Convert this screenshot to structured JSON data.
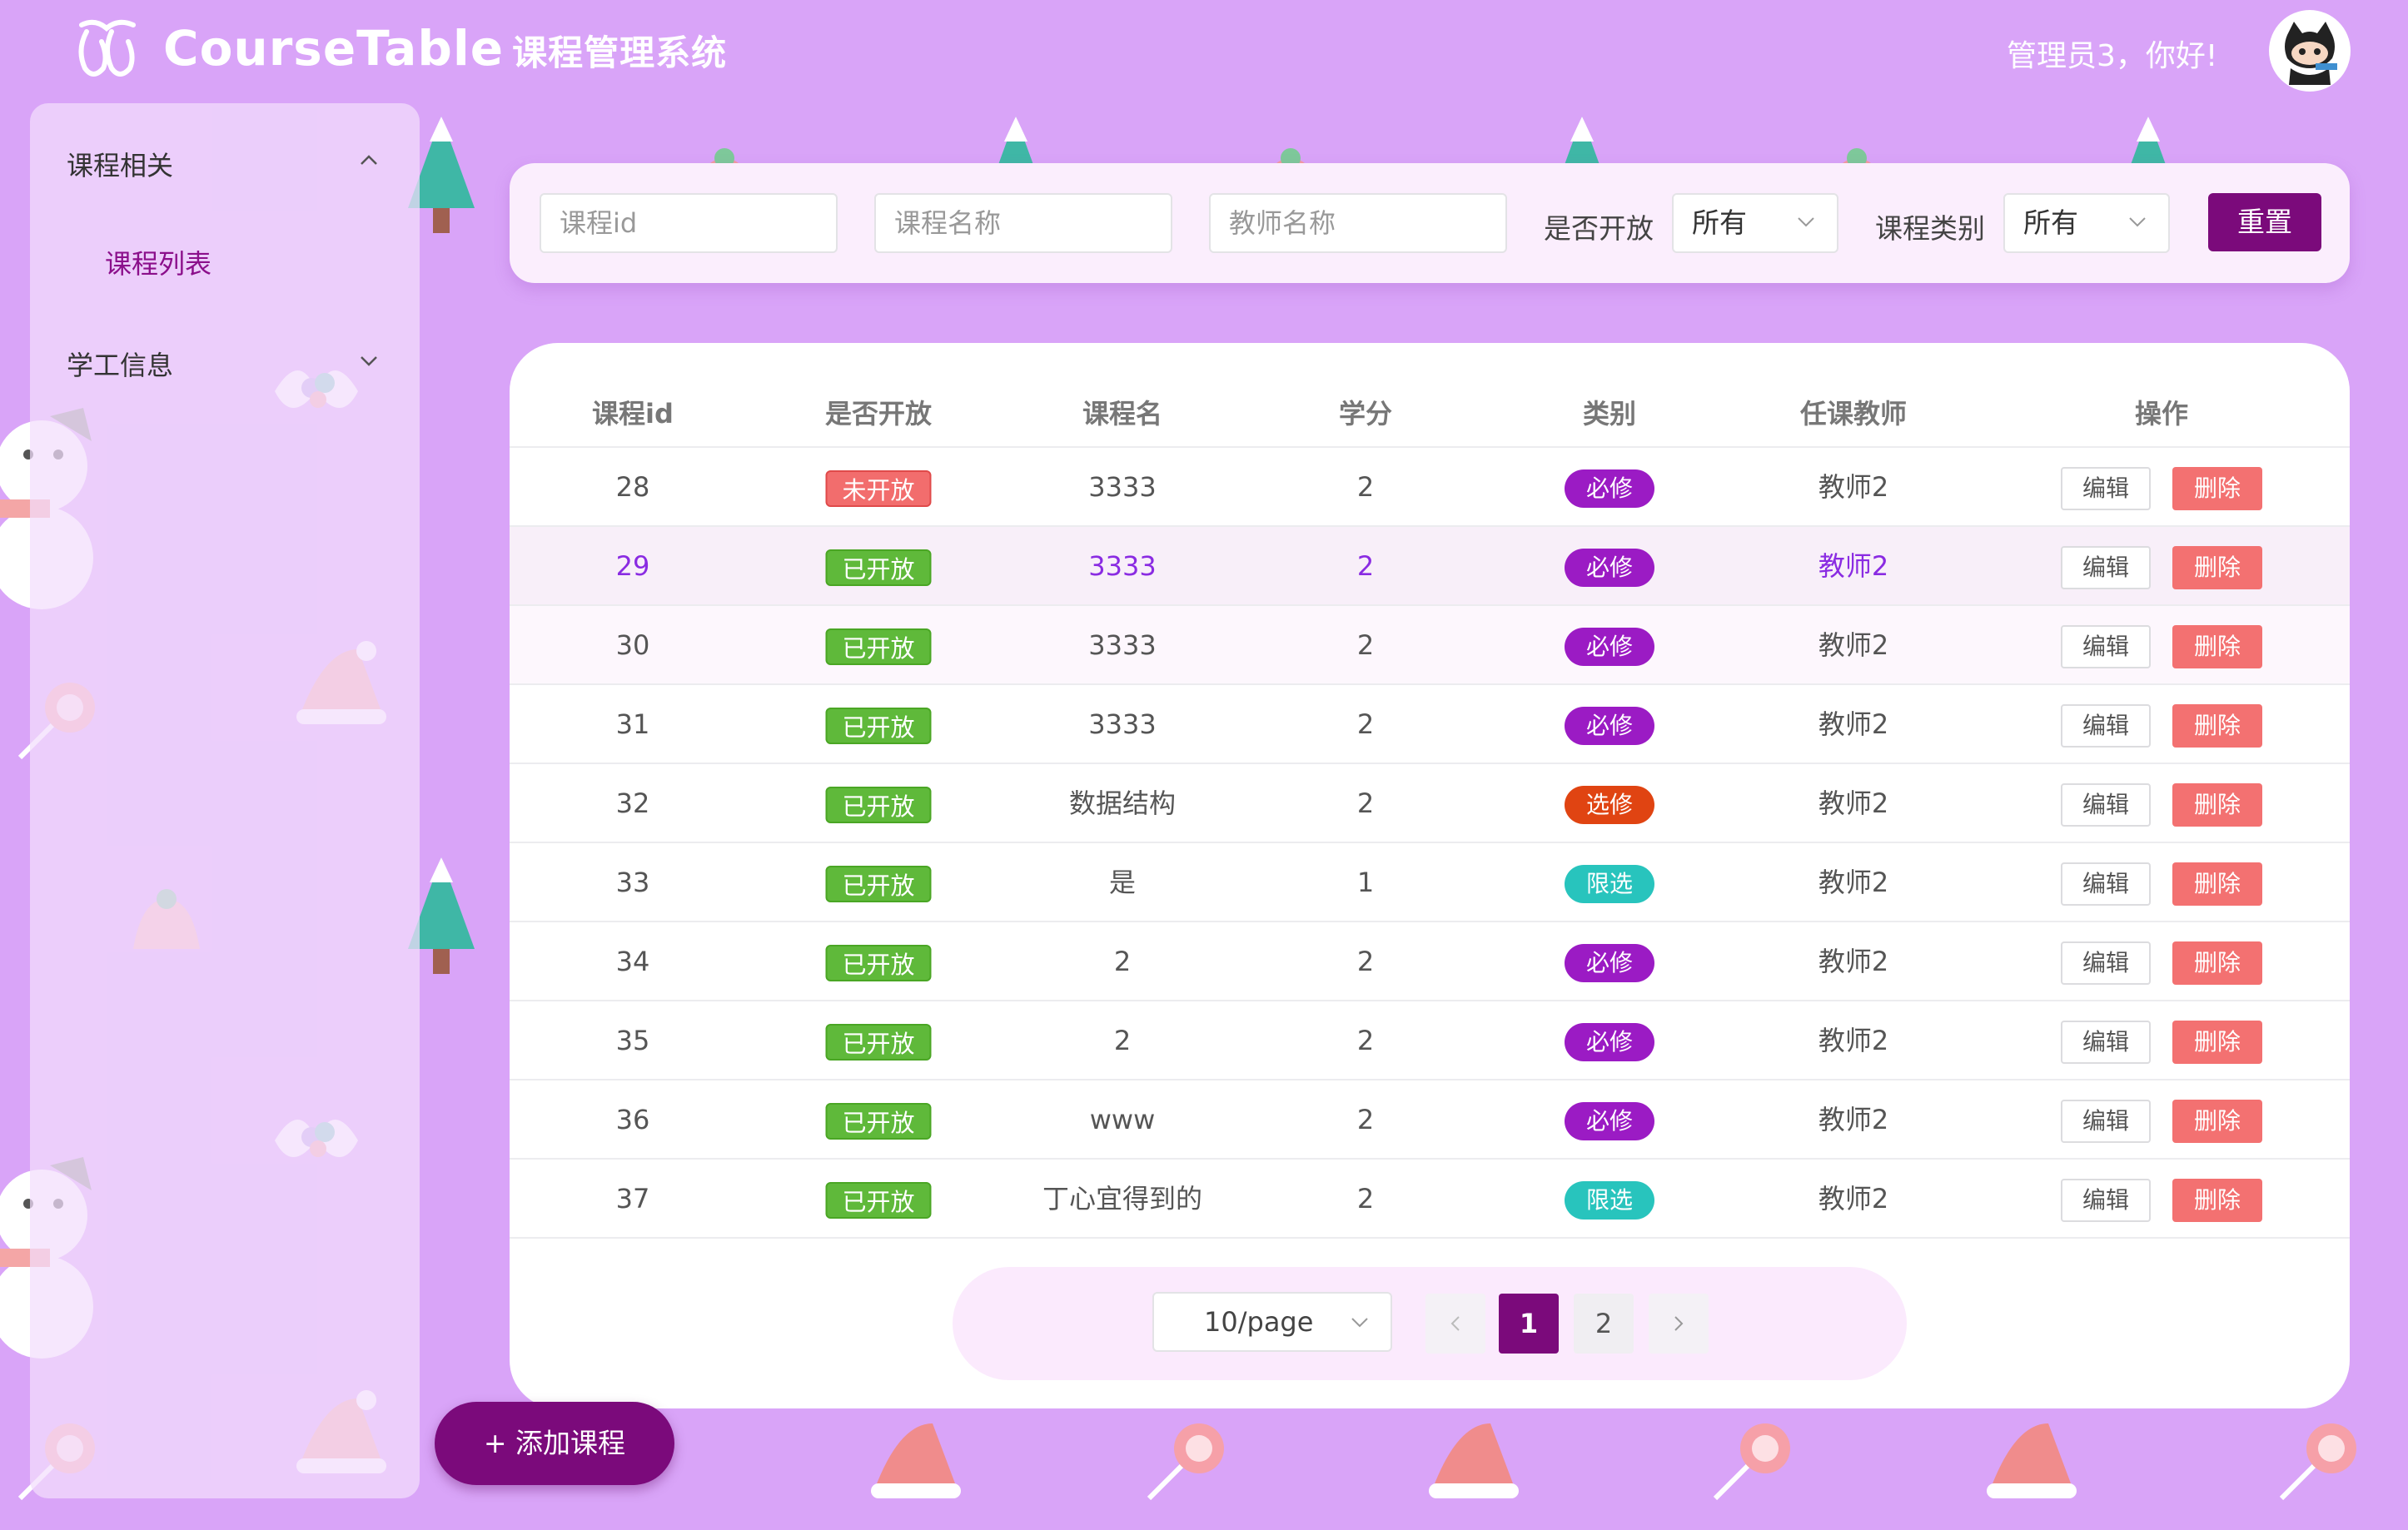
{
  "header": {
    "brand": "CourseTable",
    "brand_cn": "课程管理系统",
    "greeting": "管理员3，你好!",
    "avatar_icon": "octocat-avatar-icon"
  },
  "sidebar": {
    "groups": [
      {
        "label": "课程相关",
        "expanded": true,
        "items": [
          {
            "label": "课程列表",
            "active": true
          }
        ]
      },
      {
        "label": "学工信息",
        "expanded": false,
        "items": []
      }
    ]
  },
  "filters": {
    "course_id_placeholder": "课程id",
    "course_name_placeholder": "课程名称",
    "teacher_name_placeholder": "教师名称",
    "open_label": "是否开放",
    "open_value": "所有",
    "type_label": "课程类别",
    "type_value": "所有",
    "reset_label": "重置"
  },
  "table": {
    "columns": [
      "课程id",
      "是否开放",
      "课程名",
      "学分",
      "类别",
      "任课教师",
      "操作"
    ],
    "edit_label": "编辑",
    "delete_label": "删除",
    "rows": [
      {
        "id": "28",
        "status": "未开放",
        "name": "3333",
        "credit": "2",
        "type": "必修",
        "teacher": "教师2"
      },
      {
        "id": "29",
        "status": "已开放",
        "name": "3333",
        "credit": "2",
        "type": "必修",
        "teacher": "教师2"
      },
      {
        "id": "30",
        "status": "已开放",
        "name": "3333",
        "credit": "2",
        "type": "必修",
        "teacher": "教师2"
      },
      {
        "id": "31",
        "status": "已开放",
        "name": "3333",
        "credit": "2",
        "type": "必修",
        "teacher": "教师2"
      },
      {
        "id": "32",
        "status": "已开放",
        "name": "数据结构",
        "credit": "2",
        "type": "选修",
        "teacher": "教师2"
      },
      {
        "id": "33",
        "status": "已开放",
        "name": "是",
        "credit": "1",
        "type": "限选",
        "teacher": "教师2"
      },
      {
        "id": "34",
        "status": "已开放",
        "name": "2",
        "credit": "2",
        "type": "必修",
        "teacher": "教师2"
      },
      {
        "id": "35",
        "status": "已开放",
        "name": "2",
        "credit": "2",
        "type": "必修",
        "teacher": "教师2"
      },
      {
        "id": "36",
        "status": "已开放",
        "name": "www",
        "credit": "2",
        "type": "必修",
        "teacher": "教师2"
      },
      {
        "id": "37",
        "status": "已开放",
        "name": "丁心宜得到的",
        "credit": "2",
        "type": "限选",
        "teacher": "教师2"
      }
    ]
  },
  "pagination": {
    "page_size": "10/page",
    "pages": [
      "1",
      "2"
    ],
    "current": "1",
    "prev_icon": "chevron-left-icon",
    "next_icon": "chevron-right-icon"
  },
  "add_button_label": "+ 添加课程",
  "colors": {
    "background": "#d9a4f8",
    "accent": "#7b0a7b",
    "status_open": "#5fb93a",
    "status_closed": "#f26d6d",
    "type_required": "#9b1bc4",
    "type_elective": "#e04412",
    "type_limited": "#28c4bd",
    "delete": "#f37171"
  }
}
